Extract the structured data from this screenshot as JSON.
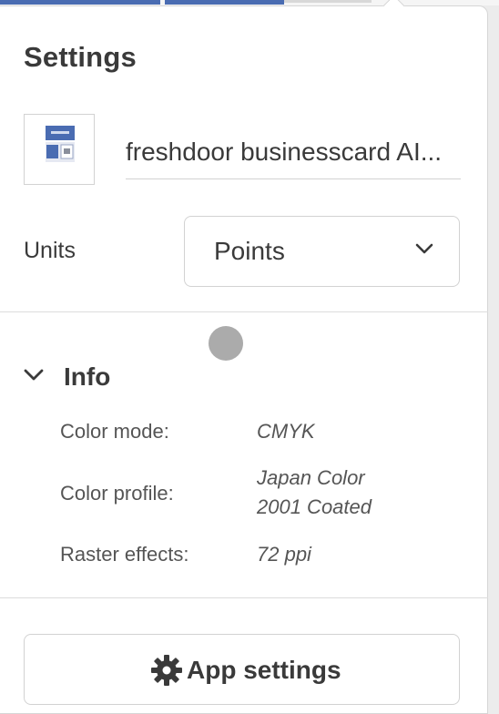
{
  "panel": {
    "title": "Settings"
  },
  "document": {
    "thumbnail_icon": "document-thumbnail-icon",
    "name": "freshdoor businesscard  AI..."
  },
  "units": {
    "label": "Units",
    "selected": "Points",
    "dropdown_icon": "chevron-down-icon"
  },
  "info": {
    "header": "Info",
    "toggle_icon": "chevron-down-icon",
    "rows": [
      {
        "label": "Color mode:",
        "value": "CMYK"
      },
      {
        "label": "Color profile:",
        "value_line1": "Japan Color",
        "value_line2": "2001 Coated"
      },
      {
        "label": "Raster effects:",
        "value": "72 ppi"
      }
    ]
  },
  "footer": {
    "app_settings_label": "App settings",
    "app_settings_icon": "gear-icon"
  },
  "colors": {
    "accent": "#4a6cb2",
    "text": "#3a3a3a",
    "border": "#d2d2d2"
  }
}
